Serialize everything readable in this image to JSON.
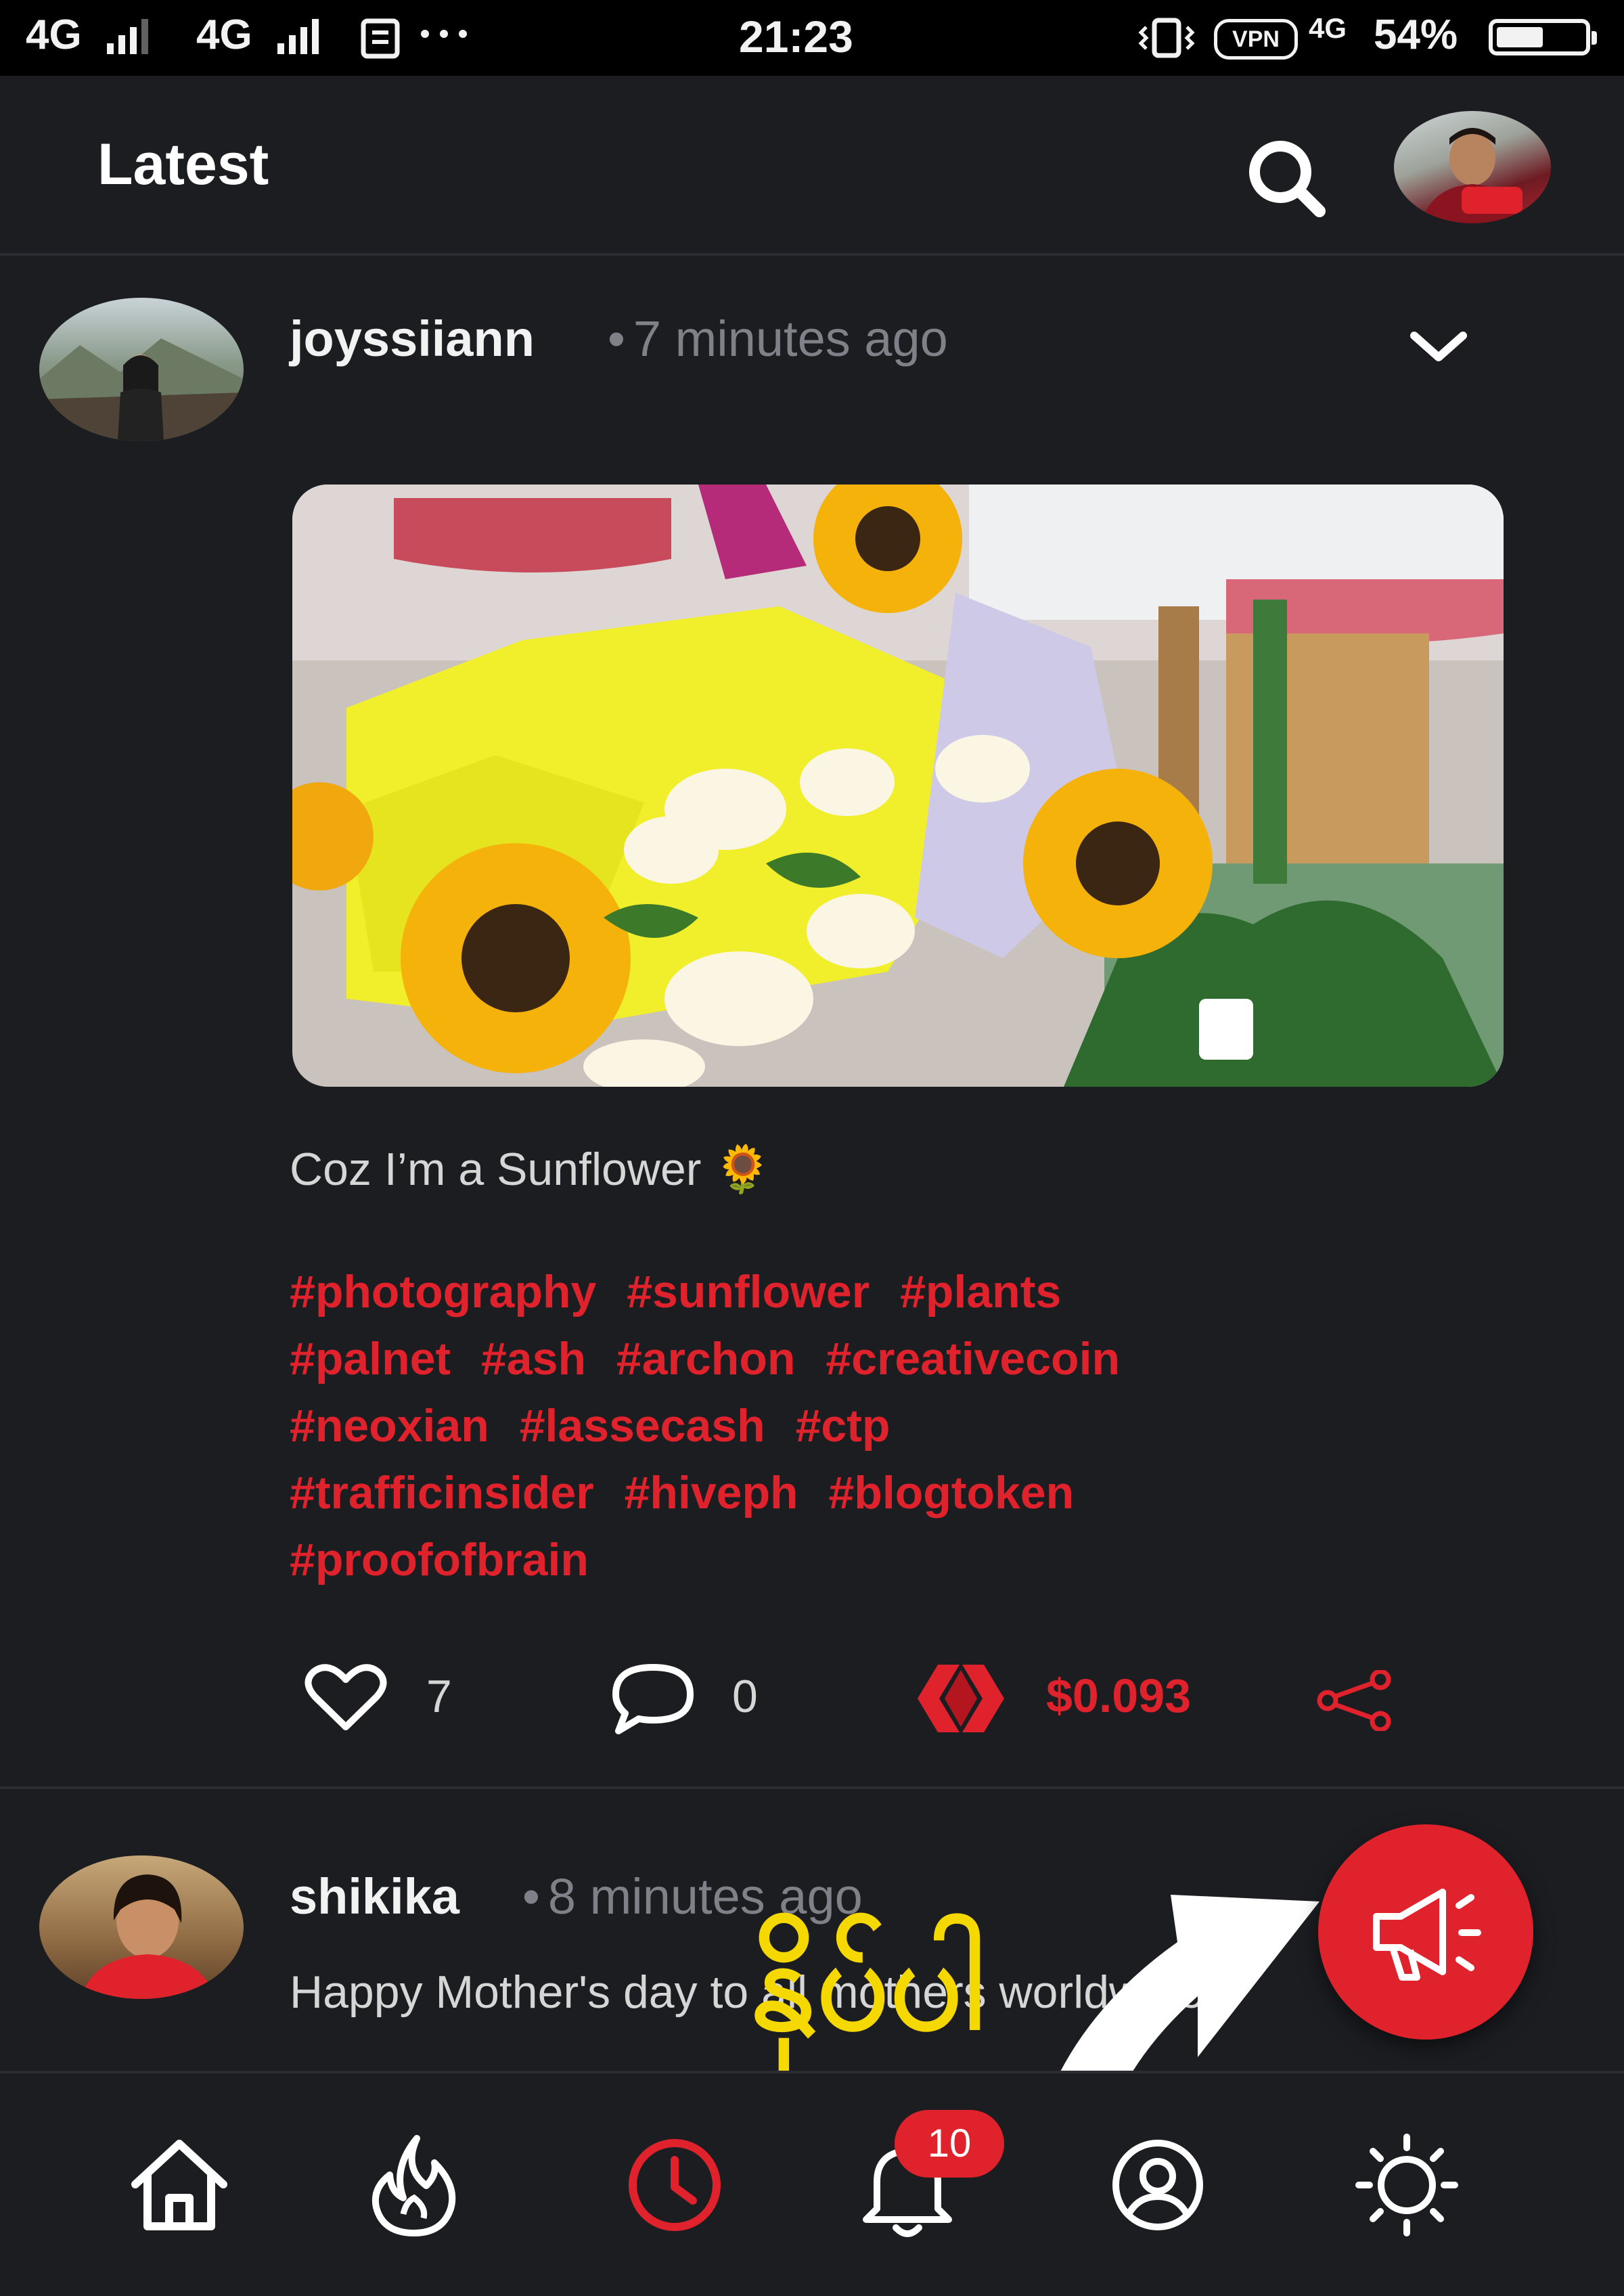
{
  "status_bar": {
    "network_1": "4G",
    "network_2": "4G",
    "time": "21:23",
    "vpn": "VPN",
    "network_3": "4G",
    "battery": "54%",
    "battery_level": 0.54
  },
  "header": {
    "title": "Latest"
  },
  "posts": [
    {
      "username": "joyssiiann",
      "timestamp": "7 minutes ago",
      "body": "Coz I’m a Sunflower 🌻",
      "tags": [
        "#photography",
        "#sunflower",
        "#plants",
        "#palnet",
        "#ash",
        "#archon",
        "#creativecoin",
        "#neoxian",
        "#lassecash",
        "#ctp",
        "#trafficinsider",
        "#hiveph",
        "#blogtoken",
        "#proofofbrain"
      ],
      "likes": "7",
      "comments": "0",
      "payout": "$0.093"
    },
    {
      "username": "shikika",
      "timestamp": "8 minutes ago",
      "body": "Happy Mother's day to all mothers worldwide!"
    }
  ],
  "bottom_nav": {
    "notification_count": "10"
  },
  "overlay": {
    "annotation_text": "နှိပ်ပါ"
  },
  "colors": {
    "background": "#1c1d21",
    "accent": "#e0222c",
    "overlay_text": "#f5d800"
  }
}
